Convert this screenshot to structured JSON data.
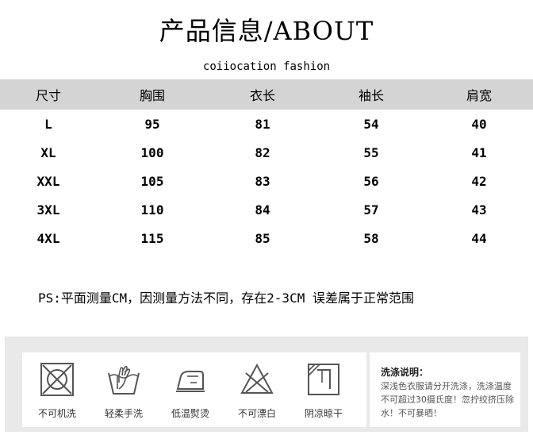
{
  "header": {
    "title": "产品信息/ABOUT",
    "subtitle": "coiiocation fashion"
  },
  "size_table": {
    "columns": [
      "尺寸",
      "胸围",
      "衣长",
      "袖长",
      "肩宽"
    ],
    "rows": [
      [
        "L",
        "95",
        "81",
        "54",
        "40"
      ],
      [
        "XL",
        "100",
        "82",
        "55",
        "41"
      ],
      [
        "XXL",
        "105",
        "83",
        "56",
        "42"
      ],
      [
        "3XL",
        "110",
        "84",
        "57",
        "43"
      ],
      [
        "4XL",
        "115",
        "85",
        "58",
        "44"
      ]
    ]
  },
  "note": "PS:平面测量CM，因测量方法不同，存在2-3CM 误差属于正常范围",
  "care": {
    "items": [
      {
        "label": "不可机洗",
        "icon": "no-machine-wash-icon"
      },
      {
        "label": "轻柔手洗",
        "icon": "hand-wash-icon"
      },
      {
        "label": "低温熨烫",
        "icon": "low-iron-icon"
      },
      {
        "label": "不可漂白",
        "icon": "no-bleach-icon"
      },
      {
        "label": "阴凉晾干",
        "icon": "shade-dry-icon"
      }
    ],
    "instructions_title": "洗涤说明：",
    "instructions_body": "深浅色衣服请分开洗涤，洗涤温度不可超过30摄氏度！忽拧绞挤压除水！不可暴晒！"
  }
}
